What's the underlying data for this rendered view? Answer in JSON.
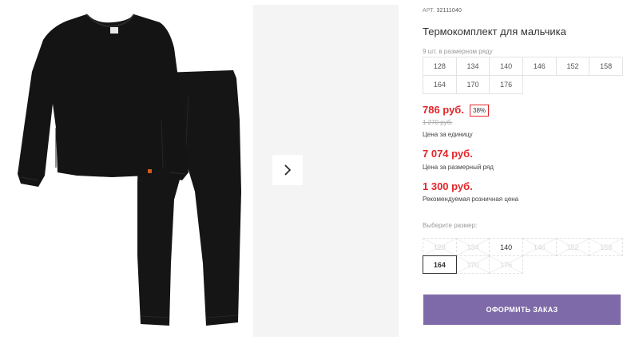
{
  "product": {
    "article_label": "АРТ.",
    "article_value": "32111040",
    "title": "Термокомплект для мальчика"
  },
  "size_range": {
    "note": "9 шт. в размерном ряду",
    "sizes": [
      "128",
      "134",
      "140",
      "146",
      "152",
      "158",
      "164",
      "170",
      "176"
    ]
  },
  "pricing": {
    "unit_price": "786 руб.",
    "discount": "38%",
    "old_price": "1 270 руб.",
    "unit_label": "Цена за единицу",
    "row_price": "7 074 руб.",
    "row_label": "Цена за размерный ряд",
    "rrp_price": "1 300 руб.",
    "rrp_label": "Рекомендуемая розничная цена"
  },
  "size_select": {
    "label": "Выберите размер:",
    "options": [
      {
        "label": "128",
        "state": "disabled"
      },
      {
        "label": "134",
        "state": "disabled"
      },
      {
        "label": "140",
        "state": "available"
      },
      {
        "label": "146",
        "state": "disabled"
      },
      {
        "label": "152",
        "state": "disabled"
      },
      {
        "label": "158",
        "state": "disabled"
      },
      {
        "label": "164",
        "state": "selected"
      },
      {
        "label": "170",
        "state": "disabled"
      },
      {
        "label": "176",
        "state": "disabled"
      }
    ]
  },
  "order_button": "ОФОРМИТЬ ЗАКАЗ",
  "colors": {
    "price_red": "#e3262a",
    "button_purple": "#7e6aa8",
    "garment_black": "#141414"
  },
  "icons": {
    "gallery_next": "chevron-right-icon"
  }
}
